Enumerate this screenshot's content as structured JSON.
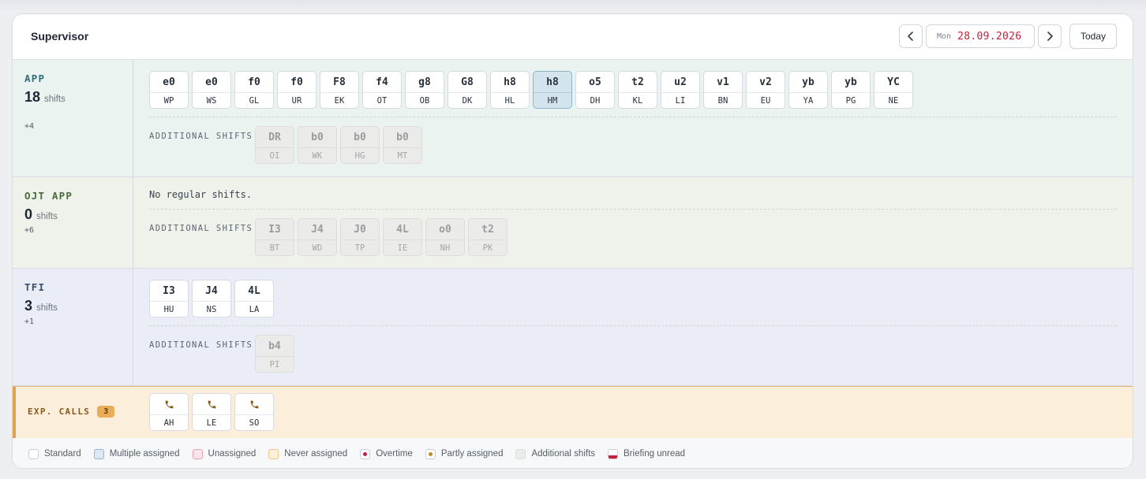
{
  "header": {
    "title": "Supervisor",
    "date_dow": "Mon",
    "date_value": "28.09.2026",
    "today_label": "Today",
    "prev_icon": "chevron-left-icon",
    "next_icon": "chevron-right-icon"
  },
  "sections": {
    "app": {
      "name": "APP",
      "count": "18",
      "count_unit": "shifts",
      "extra": "+4",
      "regular": [
        {
          "code": "e0",
          "ini": "WP"
        },
        {
          "code": "e0",
          "ini": "WS"
        },
        {
          "code": "f0",
          "ini": "GL"
        },
        {
          "code": "f0",
          "ini": "UR"
        },
        {
          "code": "F8",
          "ini": "EK"
        },
        {
          "code": "f4",
          "ini": "OT"
        },
        {
          "code": "g8",
          "ini": "OB"
        },
        {
          "code": "G8",
          "ini": "DK"
        },
        {
          "code": "h8",
          "ini": "HL"
        },
        {
          "code": "h8",
          "ini": "HM",
          "selected": true
        },
        {
          "code": "o5",
          "ini": "DH"
        },
        {
          "code": "t2",
          "ini": "KL"
        },
        {
          "code": "u2",
          "ini": "LI"
        },
        {
          "code": "v1",
          "ini": "BN"
        },
        {
          "code": "v2",
          "ini": "EU"
        },
        {
          "code": "yb",
          "ini": "YA"
        },
        {
          "code": "yb",
          "ini": "PG"
        },
        {
          "code": "YC",
          "ini": "NE"
        }
      ],
      "additional_label": "ADDITIONAL SHIFTS",
      "additional": [
        {
          "code": "DR",
          "ini": "OI"
        },
        {
          "code": "b0",
          "ini": "WK"
        },
        {
          "code": "b0",
          "ini": "HG"
        },
        {
          "code": "b0",
          "ini": "MT"
        }
      ]
    },
    "ojt": {
      "name": "OJT APP",
      "count": "0",
      "count_unit": "shifts",
      "extra": "+6",
      "no_regular": "No regular shifts.",
      "additional_label": "ADDITIONAL SHIFTS",
      "additional": [
        {
          "code": "I3",
          "ini": "BT"
        },
        {
          "code": "J4",
          "ini": "WD"
        },
        {
          "code": "J0",
          "ini": "TP"
        },
        {
          "code": "4L",
          "ini": "IE"
        },
        {
          "code": "o0",
          "ini": "NH"
        },
        {
          "code": "t2",
          "ini": "PK"
        }
      ]
    },
    "tfi": {
      "name": "TFI",
      "count": "3",
      "count_unit": "shifts",
      "extra": "+1",
      "regular": [
        {
          "code": "I3",
          "ini": "HU"
        },
        {
          "code": "J4",
          "ini": "NS"
        },
        {
          "code": "4L",
          "ini": "LA"
        }
      ],
      "additional_label": "ADDITIONAL SHIFTS",
      "additional": [
        {
          "code": "b4",
          "ini": "PI"
        }
      ]
    },
    "calls": {
      "name": "EXP. CALLS",
      "badge": "3",
      "icon": "phone-icon",
      "items": [
        {
          "ini": "AH"
        },
        {
          "ini": "LE"
        },
        {
          "ini": "SO"
        }
      ]
    }
  },
  "legend": [
    {
      "label": "Standard",
      "kind": "standard"
    },
    {
      "label": "Multiple assigned",
      "kind": "multiple"
    },
    {
      "label": "Unassigned",
      "kind": "unassigned"
    },
    {
      "label": "Never assigned",
      "kind": "never"
    },
    {
      "label": "Overtime",
      "kind": "overtime"
    },
    {
      "label": "Partly assigned",
      "kind": "partly"
    },
    {
      "label": "Additional shifts",
      "kind": "additional"
    },
    {
      "label": "Briefing unread",
      "kind": "briefing"
    }
  ],
  "colors": {
    "date_accent": "#c81e3c",
    "app_bg": "#ebf3f1",
    "ojt_bg": "#eff2ea",
    "tfi_bg": "#ebedf6",
    "calls_bg": "#fbeedb",
    "calls_accent": "#e0a24e"
  }
}
